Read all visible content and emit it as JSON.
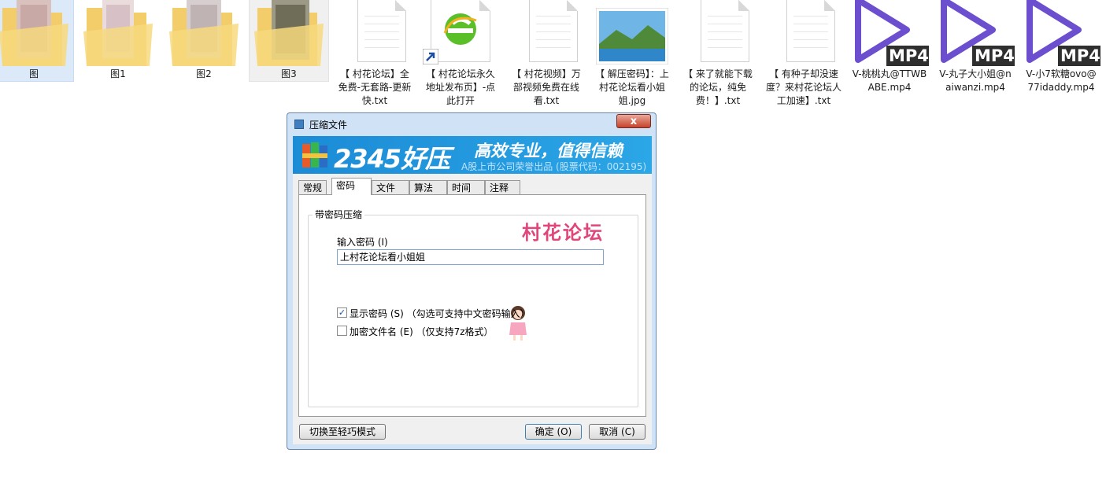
{
  "desktop": {
    "files": [
      {
        "name": "图",
        "kind": "folder"
      },
      {
        "name": "图1",
        "kind": "folder"
      },
      {
        "name": "图2",
        "kind": "folder"
      },
      {
        "name": "图3",
        "kind": "folder"
      },
      {
        "name": "【 村花论坛】全免费-无套路-更新快.txt",
        "kind": "txt"
      },
      {
        "name": "【 村花论坛永久地址发布页】-点此打开",
        "kind": "shortcut"
      },
      {
        "name": "【 村花视频】万部视频免费在线看.txt",
        "kind": "txt"
      },
      {
        "name": "【 解压密码】：上村花论坛看小姐姐.jpg",
        "kind": "jpg"
      },
      {
        "name": "【 来了就能下载的论坛，纯免费！】.txt",
        "kind": "txt"
      },
      {
        "name": "【 有种子却没速度？来村花论坛人工加速】.txt",
        "kind": "txt"
      },
      {
        "name": "V-桃桃丸@TTWBABE.mp4",
        "kind": "mp4"
      },
      {
        "name": "V-丸子大小姐@naiwanzi.mp4",
        "kind": "mp4"
      },
      {
        "name": "V-小7软糖ovo@77idaddy.mp4",
        "kind": "mp4"
      }
    ],
    "mp4_badge": "MP4",
    "accent_mp4": "#6b4fcf"
  },
  "dialog": {
    "title": "压缩文件",
    "close_label": "x",
    "banner": {
      "logo": "2345好压",
      "slogan": "高效专业，值得信赖",
      "sub": "A股上市公司荣誉出品 (股票代码：002195)"
    },
    "tabs": [
      "常规",
      "密码",
      "文件",
      "算法",
      "时间",
      "注释"
    ],
    "group_title": "带密码压缩",
    "password_label": "输入密码 (I)",
    "password_value": "上村花论坛看小姐姐",
    "show_password": {
      "label": "显示密码 (S)  （勾选可支持中文密码输入）",
      "checked": true
    },
    "encrypt_names": {
      "label": "加密文件名 (E)  （仅支持7z格式）",
      "checked": false
    },
    "buttons": {
      "switch": "切换至轻巧模式",
      "ok": "确定 (O)",
      "cancel": "取消 (C)"
    },
    "watermark": "村花论坛"
  }
}
